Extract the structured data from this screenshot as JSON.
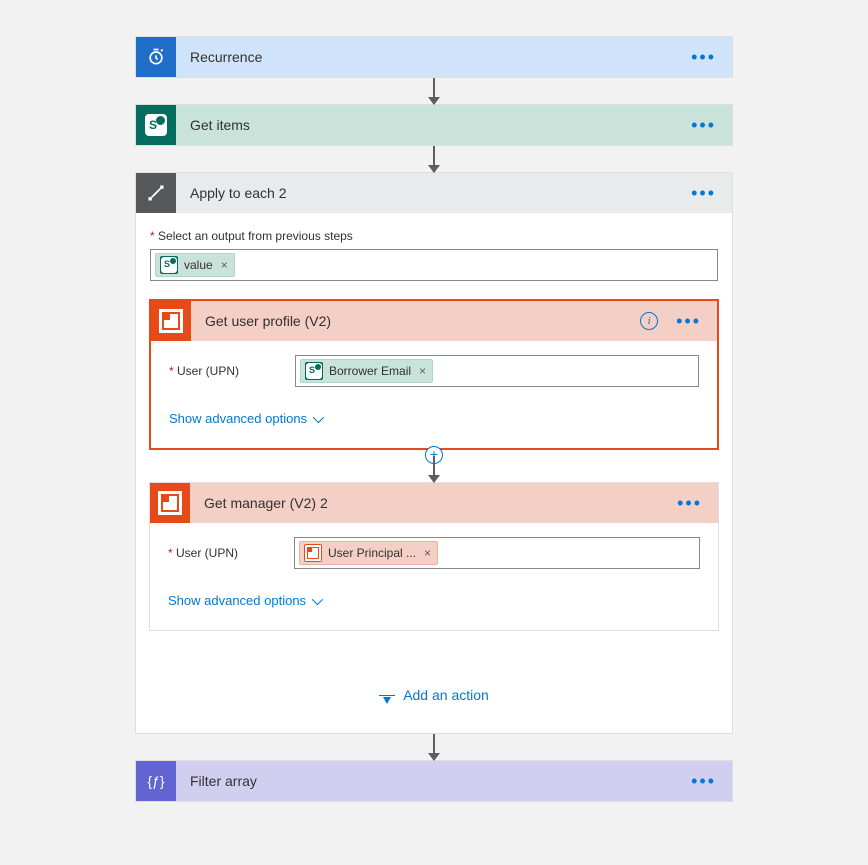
{
  "steps": {
    "recurrence": {
      "title": "Recurrence"
    },
    "getItems": {
      "title": "Get items"
    },
    "applyEach": {
      "title": "Apply to each 2",
      "selectLabel": "Select an output from previous steps",
      "token": "value"
    },
    "getUserProfile": {
      "title": "Get user profile (V2)",
      "paramLabel": "User (UPN)",
      "token": "Borrower Email",
      "advanced": "Show advanced options"
    },
    "getManager": {
      "title": "Get manager (V2) 2",
      "paramLabel": "User (UPN)",
      "token": "User Principal ...",
      "advanced": "Show advanced options"
    },
    "filterArray": {
      "title": "Filter array"
    }
  },
  "addAction": "Add an action"
}
